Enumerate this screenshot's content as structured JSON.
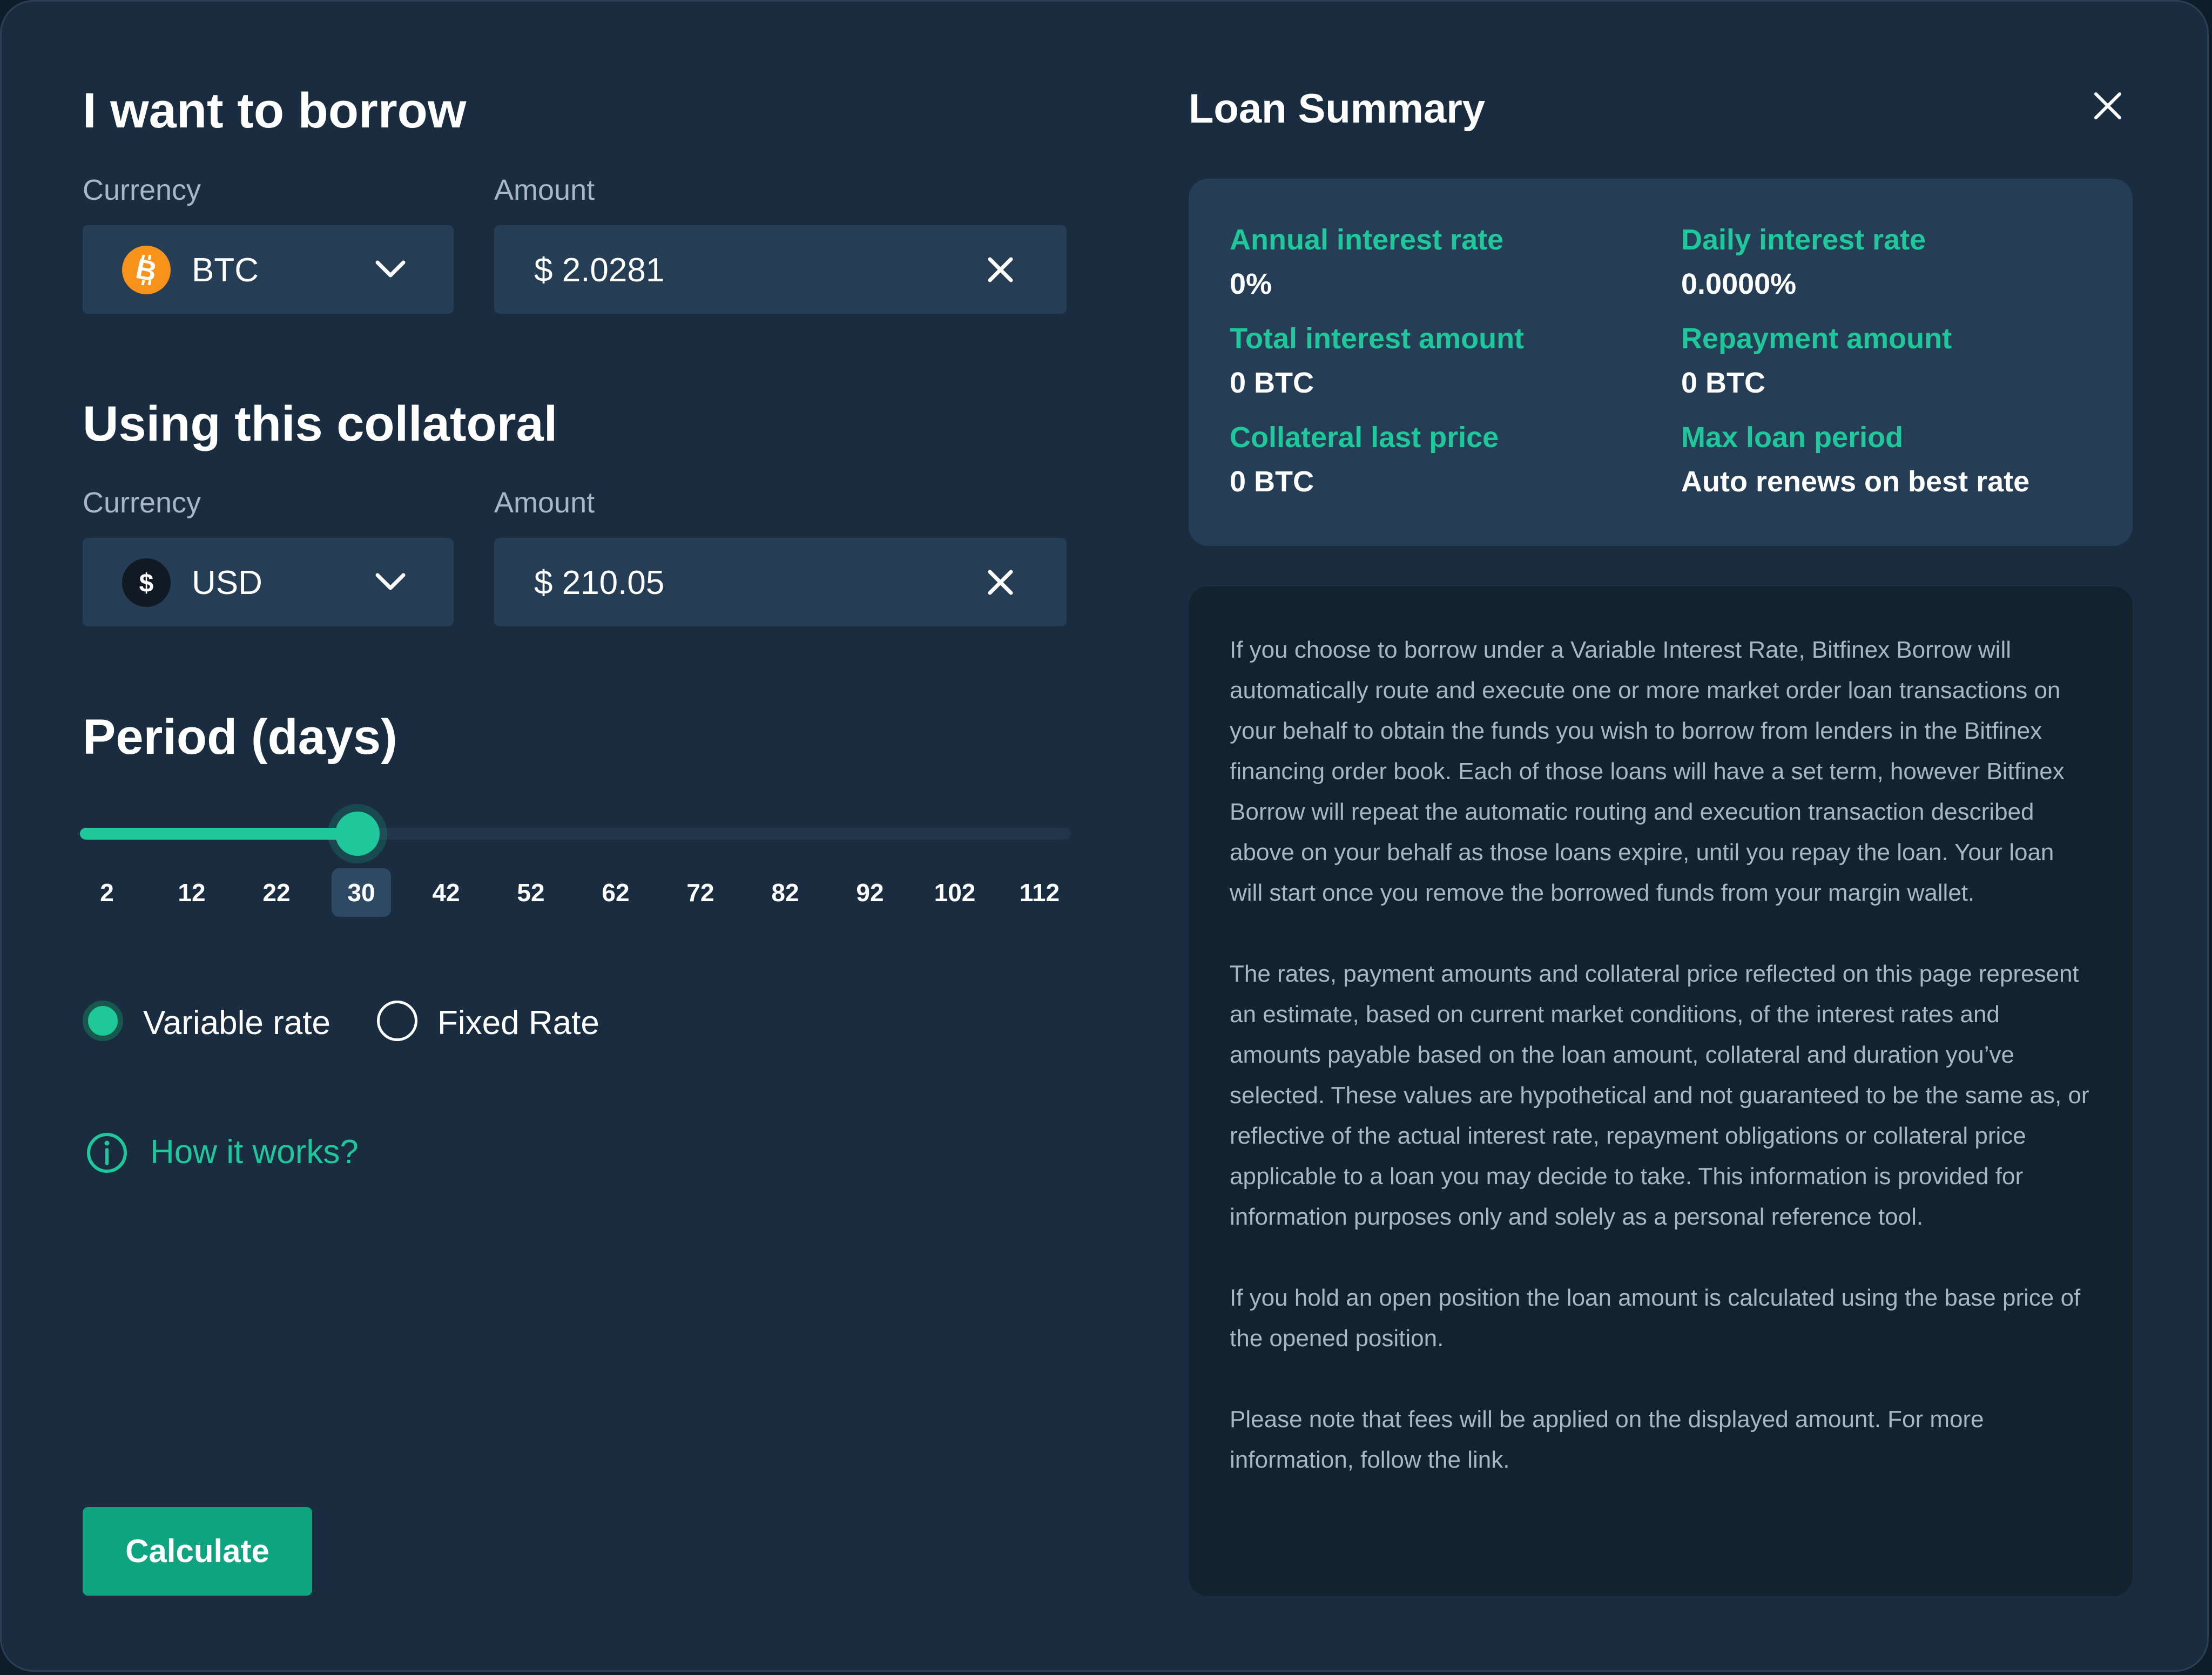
{
  "borrow": {
    "title": "I want to borrow",
    "currency_label": "Currency",
    "amount_label": "Amount",
    "currency_value": "BTC",
    "currency_icon": "bitcoin-icon",
    "amount_value": "$ 2.0281"
  },
  "collateral": {
    "title": "Using this collatoral",
    "currency_label": "Currency",
    "amount_label": "Amount",
    "currency_value": "USD",
    "currency_icon": "dollar-icon",
    "amount_value": "$ 210.05"
  },
  "period": {
    "title": "Period (days)",
    "ticks": [
      "2",
      "12",
      "22",
      "30",
      "42",
      "52",
      "62",
      "72",
      "82",
      "92",
      "102",
      "112"
    ],
    "selected": "30",
    "selected_fraction": 0.28
  },
  "rate_options": {
    "variable": "Variable rate",
    "fixed": "Fixed Rate",
    "selected": "variable"
  },
  "how_it_works": "How it works?",
  "calculate_label": "Calculate",
  "summary": {
    "title": "Loan Summary",
    "annual_rate_label": "Annual interest rate",
    "annual_rate_value": "0%",
    "daily_rate_label": "Daily interest rate",
    "daily_rate_value": "0.0000%",
    "total_interest_label": "Total interest amount",
    "total_interest_value": "0 BTC",
    "repayment_label": "Repayment amount",
    "repayment_value": "0 BTC",
    "collateral_price_label": "Collateral last price",
    "collateral_price_value": "0 BTC",
    "max_period_label": "Max loan period",
    "max_period_value": "Auto renews on best rate"
  },
  "disclaimer": {
    "p1": "If you choose to borrow under a Variable Interest Rate, Bitfinex Borrow will automatically route and execute one or more market order loan transactions on your behalf to obtain the funds you wish to borrow from lenders in the Bitfinex financing order book. Each of those loans will have a set term, however Bitfinex Borrow will repeat the automatic routing and execution transaction described above on your behalf as those loans expire, until you repay the loan. Your loan will start once you remove the borrowed funds from your margin wallet.",
    "p2": "The rates, payment amounts and collateral price reflected on this page represent an estimate, based on current market conditions, of the interest rates and amounts payable based on the loan amount, collateral and duration you’ve selected. These values are hypothetical and not guaranteed to be the same as, or reflective of the actual interest rate, repayment obligations or collateral price applicable to a loan you may decide to take. This information is provided for information purposes only and solely as a personal reference tool.",
    "p3": "If you hold an open position the loan amount is calculated using the base price of the opened position.",
    "p4": "Please note that fees will be applied on the displayed amount. For more information, follow the link."
  },
  "colors": {
    "accent": "#1ec89b",
    "button": "#0ea47f",
    "background": "#1a2c40",
    "field": "#263d56",
    "bitcoin": "#f7931a"
  }
}
